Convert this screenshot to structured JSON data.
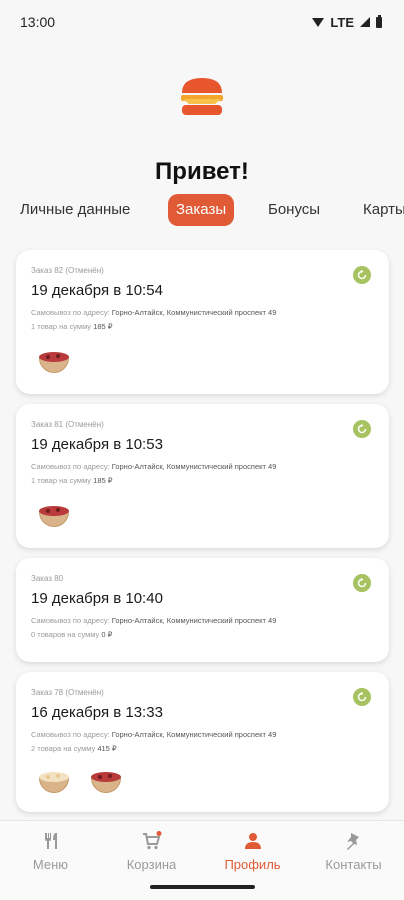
{
  "status_bar": {
    "time": "13:00",
    "network": "LTE"
  },
  "greeting": "Привет!",
  "tabs": [
    {
      "label": "Личные данные",
      "active": false
    },
    {
      "label": "Заказы",
      "active": true
    },
    {
      "label": "Бонусы",
      "active": false
    },
    {
      "label": "Карты",
      "active": false
    }
  ],
  "orders": [
    {
      "number": "Заказ 82 (Отменён)",
      "date": "19 декабря в 10:54",
      "address_label": "Самовывоз по адресу:",
      "address": "Горно-Алтайск, Коммунистический проспект 49",
      "items_label": "1 товар на сумму",
      "sum": "185 ₽",
      "thumbs": [
        "berries"
      ]
    },
    {
      "number": "Заказ 81 (Отменён)",
      "date": "19 декабря в 10:53",
      "address_label": "Самовывоз по адресу:",
      "address": "Горно-Алтайск, Коммунистический проспект 49",
      "items_label": "1 товар на сумму",
      "sum": "185 ₽",
      "thumbs": [
        "berries"
      ]
    },
    {
      "number": "Заказ 80",
      "date": "19 декабря в 10:40",
      "address_label": "Самовывоз по адресу:",
      "address": "Горно-Алтайск, Коммунистический проспект 49",
      "items_label": "0 товаров на сумму",
      "sum": "0 ₽",
      "thumbs": []
    },
    {
      "number": "Заказ 78 (Отменён)",
      "date": "16 декабря в 13:33",
      "address_label": "Самовывоз по адресу:",
      "address": "Горно-Алтайск, Коммунистический проспект 49",
      "items_label": "2 товара на сумму",
      "sum": "415 ₽",
      "thumbs": [
        "cream",
        "berries"
      ]
    }
  ],
  "bottom_nav": [
    {
      "label": "Меню",
      "icon": "fork-knife-icon",
      "active": false
    },
    {
      "label": "Корзина",
      "icon": "cart-icon",
      "active": false
    },
    {
      "label": "Профиль",
      "icon": "person-icon",
      "active": true
    },
    {
      "label": "Контакты",
      "icon": "pin-icon",
      "active": false
    }
  ],
  "colors": {
    "accent": "#e05a36",
    "repeat": "#a7c260"
  }
}
